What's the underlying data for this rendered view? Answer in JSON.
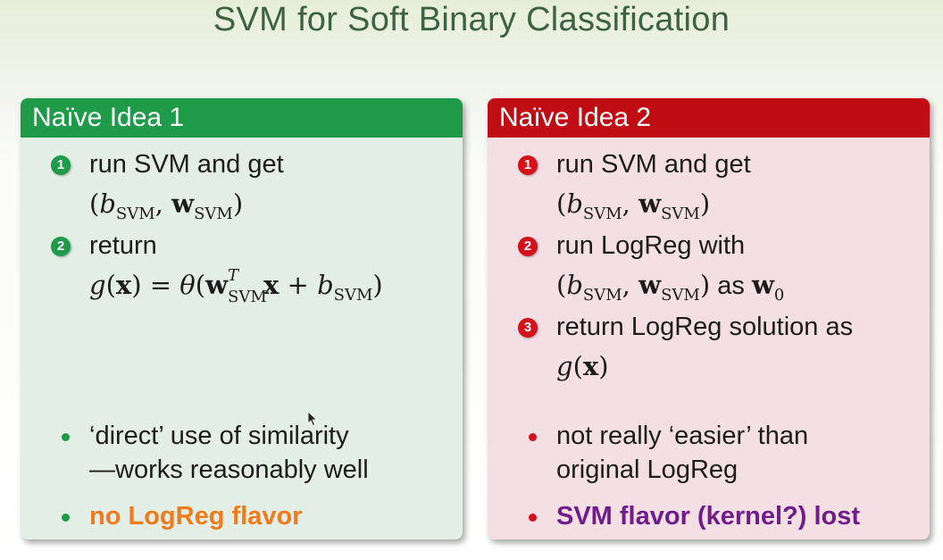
{
  "slide": {
    "title": "SVM for Soft Binary Classification"
  },
  "idea1": {
    "header": "Naïve Idea 1",
    "steps": [
      {
        "num": "1",
        "line1": "run SVM and get"
      },
      {
        "num": "2",
        "line1": "return"
      }
    ],
    "bullets": [
      {
        "line1": "‘direct’ use of similarity",
        "line2": "—works reasonably well"
      },
      {
        "line1": "no LogReg flavor"
      }
    ]
  },
  "idea2": {
    "header": "Naïve Idea 2",
    "steps": [
      {
        "num": "1",
        "line1": "run SVM and get"
      },
      {
        "num": "2",
        "line1": "run LogReg with",
        "line2_suffix": "as"
      },
      {
        "num": "3",
        "line1": "return LogReg solution as"
      }
    ],
    "bullets": [
      {
        "line1": "not really ‘easier’ than",
        "line2": "original LogReg"
      },
      {
        "line1": "SVM flavor (kernel?) lost"
      }
    ]
  },
  "math": {
    "b": "b",
    "w": "w",
    "svm": "SVM",
    "T": "T",
    "x": "x",
    "g": "g",
    "theta": "θ",
    "zero": "0"
  },
  "colors": {
    "idea1_header": "#1f9a49",
    "idea2_header": "#c00d14",
    "no_logreg_text": "#f07b1c",
    "svm_flavor_text": "#6f1d8a"
  }
}
